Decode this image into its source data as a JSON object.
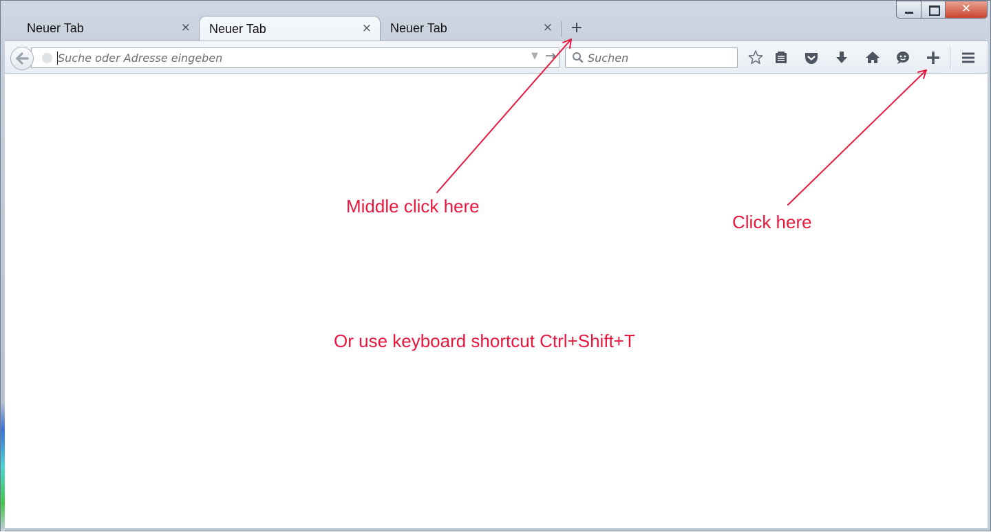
{
  "tabs": [
    {
      "label": "Neuer Tab",
      "close": "×",
      "active": false
    },
    {
      "label": "Neuer Tab",
      "close": "×",
      "active": true
    },
    {
      "label": "Neuer Tab",
      "close": "×",
      "active": false
    }
  ],
  "new_tab_symbol": "+",
  "window_controls": {
    "close": "✕"
  },
  "urlbar": {
    "placeholder": "Suche oder Adresse eingeben",
    "value": ""
  },
  "searchbar": {
    "placeholder": "Suchen",
    "value": ""
  },
  "toolbar_icons": [
    "star-icon",
    "reading-list-icon",
    "pocket-icon",
    "download-icon",
    "home-icon",
    "chat-icon",
    "plus-icon",
    "hamburger-menu-icon"
  ],
  "annotations": {
    "middle_click": "Middle click here",
    "click": "Click here",
    "shortcut": "Or use keyboard shortcut Ctrl+Shift+T"
  },
  "colors": {
    "annotation": "#e8173d",
    "accent": "#3b82d9"
  }
}
